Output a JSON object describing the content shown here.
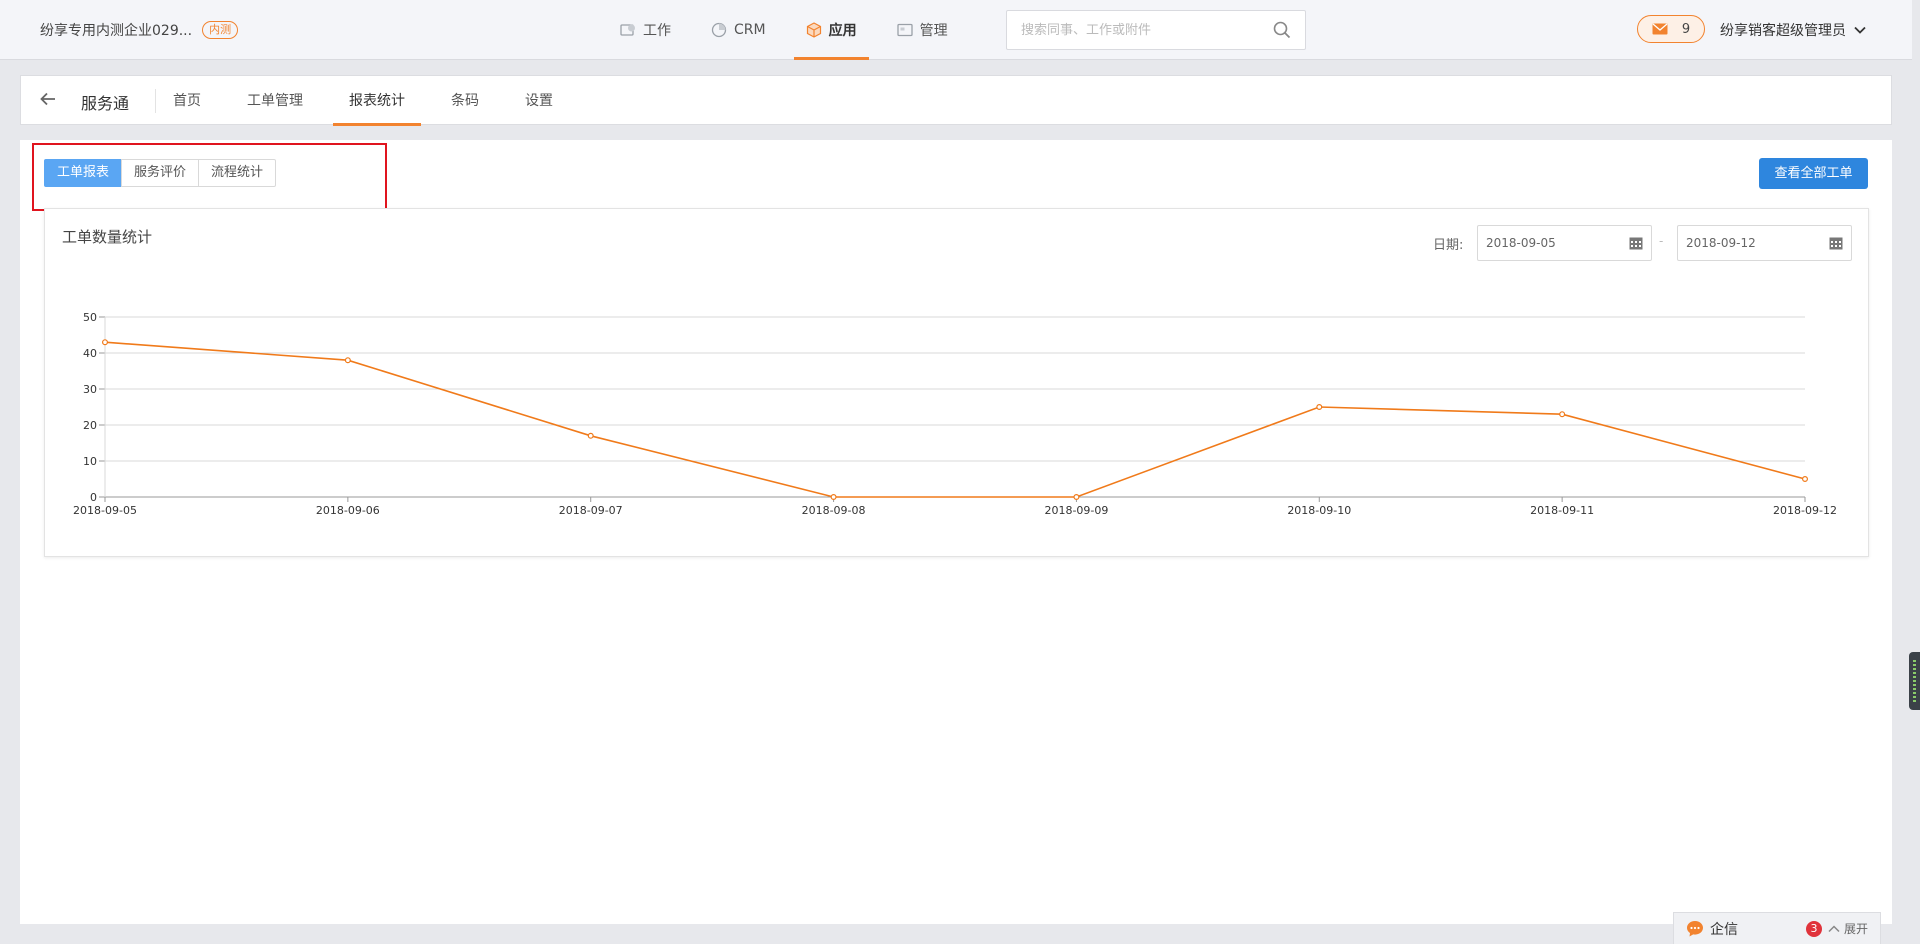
{
  "topbar": {
    "company_name": "纷享专用内测企业029...",
    "test_badge": "内测",
    "nav": [
      {
        "label": "工作",
        "icon": "work-icon"
      },
      {
        "label": "CRM",
        "icon": "crm-icon"
      },
      {
        "label": "应用",
        "icon": "app-cube-icon",
        "active": true
      },
      {
        "label": "管理",
        "icon": "manage-icon"
      }
    ],
    "search_placeholder": "搜索同事、工作或附件",
    "mail_count": "9",
    "user_name": "纷享销客超级管理员"
  },
  "subnav": {
    "app_name": "服务通",
    "tabs": [
      "首页",
      "工单管理",
      "报表统计",
      "条码",
      "设置"
    ],
    "active_tab": "报表统计"
  },
  "report": {
    "segments": [
      "工单报表",
      "服务评价",
      "流程统计"
    ],
    "active_segment": "工单报表",
    "view_all_label": "查看全部工单",
    "chart_title": "工单数量统计",
    "date_label": "日期:",
    "date_start": "2018-09-05",
    "date_sep": "-",
    "date_end": "2018-09-12"
  },
  "chart_data": {
    "type": "line",
    "title": "工单数量统计",
    "x": [
      "2018-09-05",
      "2018-09-06",
      "2018-09-07",
      "2018-09-08",
      "2018-09-09",
      "2018-09-10",
      "2018-09-11",
      "2018-09-12"
    ],
    "series": [
      {
        "values": [
          43,
          38,
          17,
          0,
          0,
          25,
          23,
          5
        ]
      }
    ],
    "yticks": [
      0,
      10,
      20,
      30,
      40,
      50
    ],
    "ylim": [
      0,
      50
    ],
    "grid": true,
    "color": "#f07a1a"
  },
  "chat": {
    "label": "企信",
    "unread": "3",
    "expand_label": "展开"
  },
  "colors": {
    "accent": "#f2832f",
    "primary": "#2e86de",
    "segment_active": "#5aa6f3",
    "highlight_box": "#e0141e"
  }
}
